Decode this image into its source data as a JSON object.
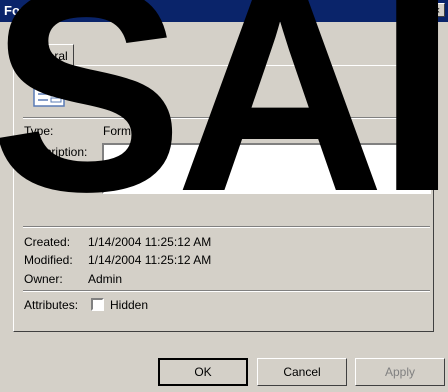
{
  "window": {
    "title": "Form1 Properties",
    "close_glyph": "×"
  },
  "tabs": [
    {
      "label": "General"
    }
  ],
  "header": {
    "name": "Form1",
    "icon": "form-icon"
  },
  "fields": {
    "type_label": "Type:",
    "type_value": "Form",
    "description_label": "Description:",
    "description_value": "",
    "created_label": "Created:",
    "created_value": "1/14/2004 11:25:12 AM",
    "modified_label": "Modified:",
    "modified_value": "1/14/2004 11:25:12 AM",
    "owner_label": "Owner:",
    "owner_value": "Admin",
    "attributes_label": "Attributes:",
    "hidden_label": "Hidden",
    "hidden_checked": false
  },
  "buttons": {
    "ok": "OK",
    "cancel": "Cancel",
    "apply": "Apply"
  },
  "watermark": "SAI"
}
